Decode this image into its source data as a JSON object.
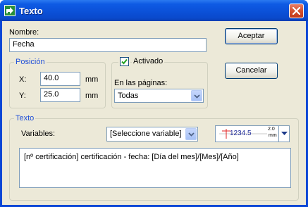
{
  "window": {
    "title": "Texto",
    "accent": "#0a47d6"
  },
  "form": {
    "name_label": "Nombre:",
    "name_value": "Fecha"
  },
  "position": {
    "title": "Posición",
    "x_label": "X:",
    "x_value": "40.0",
    "x_unit": "mm",
    "y_label": "Y:",
    "y_value": "25.0",
    "y_unit": "mm"
  },
  "pages": {
    "activated_label": "Activado",
    "activated_checked": true,
    "pages_label": "En las páginas:",
    "pages_value": "Todas"
  },
  "buttons": {
    "accept": "Aceptar",
    "cancel": "Cancelar"
  },
  "text_group": {
    "title": "Texto",
    "variables_label": "Variables:",
    "variables_value": "[Seleccione variable]",
    "font_size_preview": "1234.5",
    "spacing_top": "2.0",
    "spacing_unit": "mm",
    "content": "[nº certificación] certificación - fecha: [Día del mes]/[Mes]/[Año]"
  }
}
